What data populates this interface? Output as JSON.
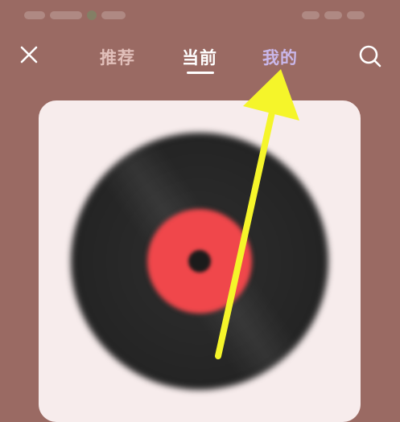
{
  "theme": {
    "background": "#9a6a63",
    "card": "#f7ecec",
    "accent": "#f0474b",
    "tab_muted": "#e9c9c4",
    "tab_mine": "#c9b7ea",
    "annotation_arrow": "#f5f52a"
  },
  "header": {
    "tabs": [
      {
        "label": "推荐"
      },
      {
        "label": "当前"
      },
      {
        "label": "我的"
      }
    ],
    "selected_tab": "当前"
  },
  "icons": {
    "close": "close-icon",
    "search": "search-icon",
    "record": "vinyl-record-icon"
  }
}
